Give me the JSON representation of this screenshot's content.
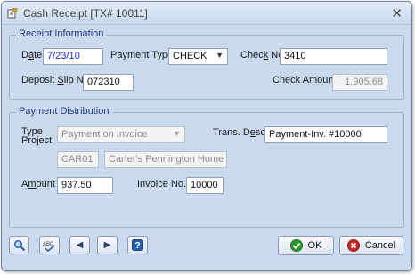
{
  "window": {
    "title": "Cash Receipt [TX# 10011]"
  },
  "receipt_info": {
    "legend": "Receipt Information",
    "date_label_pre": "D",
    "date_label_ul": "a",
    "date_label_post": "te",
    "date_value": "7/23/10",
    "payment_type_label": "Payment Type",
    "payment_type_value": "CHECK",
    "check_no_label_pre": "Chec",
    "check_no_label_ul": "k",
    "check_no_label_post": " No.",
    "check_no_value": "3410",
    "deposit_slip_label_pre": "Deposit ",
    "deposit_slip_label_ul": "S",
    "deposit_slip_label_post": "lip No.",
    "deposit_slip_value": "072310",
    "check_amount_label": "Check Amount",
    "check_amount_value": "1,905.68"
  },
  "payment_dist": {
    "legend": "Payment Distribution",
    "type_label": "Type",
    "project_label": "Project",
    "type_value": "Payment on Invoice",
    "trans_desc_label_pre": "Trans. D",
    "trans_desc_label_ul": "e",
    "trans_desc_label_post": "sc.",
    "trans_desc_value": "Payment-Inv. #10000",
    "project_code": "CAR01",
    "project_name": "Carter's Pennington Home",
    "amount_label_pre": "A",
    "amount_label_ul": "m",
    "amount_label_post": "ount",
    "amount_value": "937.50",
    "invoice_no_label": "Invoice No.",
    "invoice_no_value": "10000"
  },
  "footer": {
    "ok_label": "OK",
    "cancel_label": "Cancel",
    "abc_label": "ABC"
  },
  "colors": {
    "window_bg": "#cbd9ee",
    "legend_text": "#1f3b7a",
    "ok_green": "#2e9a2e",
    "cancel_red": "#c62828"
  }
}
